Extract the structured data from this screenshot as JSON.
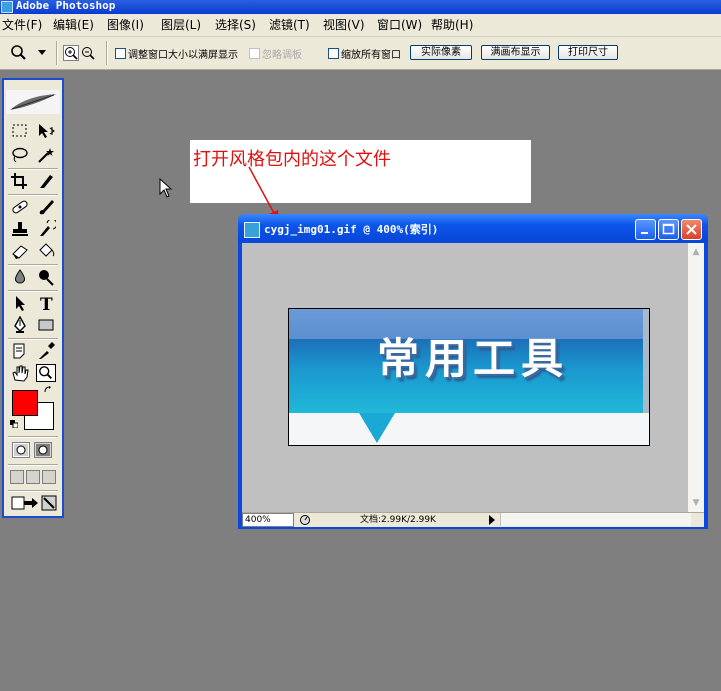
{
  "app": {
    "title": "Adobe Photoshop"
  },
  "menu": [
    "文件(F)",
    "编辑(E)",
    "图像(I)",
    "图层(L)",
    "选择(S)",
    "滤镜(T)",
    "视图(V)",
    "窗口(W)",
    "帮助(H)"
  ],
  "options": {
    "resize_windows": "调整窗口大小以满屏显示",
    "ignore_palettes": "忽略调板",
    "zoom_all": "缩放所有窗口",
    "actual_pixels": "实际像素",
    "fit_on_screen": "满画布显示",
    "print_size": "打印尺寸"
  },
  "annotation": {
    "text": "打开风格包内的这个文件"
  },
  "document": {
    "title": "cygj_img01.gif @ 400%(索引)",
    "zoom": "400%",
    "doc_info": "文档:2.99K/2.99K",
    "image_text": "常用工具"
  },
  "colors": {
    "foreground": "#ff0000",
    "background": "#ffffff",
    "accent": "#0a48e0"
  }
}
